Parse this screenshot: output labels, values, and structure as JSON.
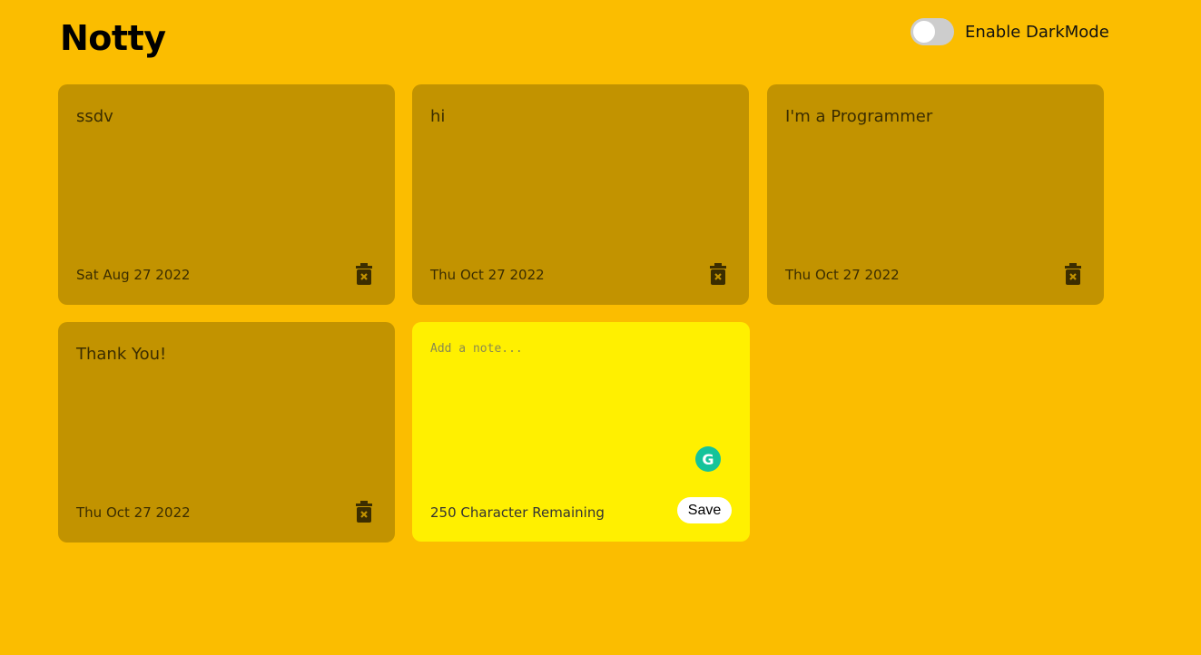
{
  "app": {
    "title": "Notty"
  },
  "darkmode": {
    "label": "Enable DarkMode",
    "enabled": false
  },
  "notes": [
    {
      "text": "ssdv",
      "date": "Sat Aug 27 2022"
    },
    {
      "text": "hi",
      "date": "Thu Oct 27 2022"
    },
    {
      "text": "I'm a Programmer",
      "date": "Thu Oct 27 2022"
    },
    {
      "text": "Thank You!",
      "date": "Thu Oct 27 2022"
    }
  ],
  "new_note": {
    "placeholder": "Add a note...",
    "remaining_text": "250 Character Remaining",
    "save_label": "Save",
    "grammarly_icon": "G"
  },
  "colors": {
    "background": "#fbbd00",
    "note_bg": "#c29300",
    "new_note_bg": "#fff000",
    "icon": "#3b2d00"
  },
  "icons": {
    "delete": "trash-icon",
    "grammarly": "grammarly-icon"
  }
}
